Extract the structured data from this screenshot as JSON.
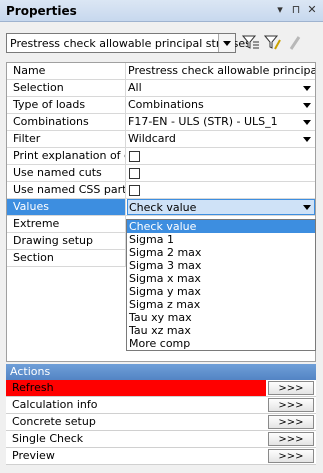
{
  "panel": {
    "title": "Properties"
  },
  "toolbar": {
    "command_selector_value": "Prestress check allowable principal stresses"
  },
  "properties": [
    {
      "label": "Name",
      "value": "Prestress check allowable principal s...",
      "kind": "text"
    },
    {
      "label": "Selection",
      "value": "All",
      "kind": "dropdown"
    },
    {
      "label": "Type of loads",
      "value": "Combinations",
      "kind": "dropdown"
    },
    {
      "label": "Combinations",
      "value": "F17-EN - ULS (STR) - ULS_1",
      "kind": "dropdown"
    },
    {
      "label": "Filter",
      "value": "Wildcard",
      "kind": "dropdown"
    },
    {
      "label": "Print explanation of e...",
      "value": "",
      "kind": "checkbox",
      "checked": false
    },
    {
      "label": "Use named cuts",
      "value": "",
      "kind": "checkbox",
      "checked": false
    },
    {
      "label": "Use named CSS parts",
      "value": "",
      "kind": "checkbox",
      "checked": false
    },
    {
      "label": "Values",
      "value": "Check value",
      "kind": "dropdown",
      "selected": true
    },
    {
      "label": "Extreme",
      "value": "",
      "kind": "text"
    },
    {
      "label": "Drawing setup",
      "value": "",
      "kind": "text"
    },
    {
      "label": "Section",
      "value": "",
      "kind": "text"
    }
  ],
  "values_dropdown": {
    "options": [
      "Check value",
      "Sigma 1",
      "Sigma 2 max",
      "Sigma 3 max",
      "Sigma x max",
      "Sigma y max",
      "Sigma z max",
      "Tau xy max",
      "Tau xz max",
      "More comp"
    ],
    "highlighted": "Check value"
  },
  "actions": {
    "header": "Actions",
    "items": [
      {
        "label": "Refresh",
        "button": ">>>"
      },
      {
        "label": "Calculation info",
        "button": ">>>"
      },
      {
        "label": "Concrete setup",
        "button": ">>>"
      },
      {
        "label": "Single Check",
        "button": ">>>"
      },
      {
        "label": "Preview",
        "button": ">>>"
      }
    ]
  }
}
